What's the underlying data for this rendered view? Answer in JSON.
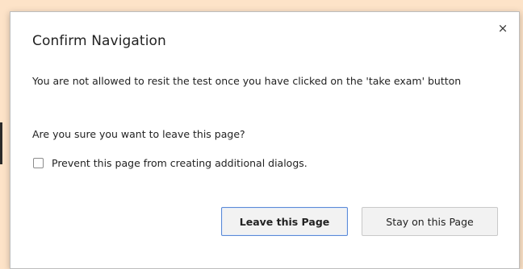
{
  "dialog": {
    "title": "Confirm Navigation",
    "close_symbol": "×",
    "message": "You are not allowed to resit the test once you have clicked on the 'take exam' button",
    "question": "Are you sure you want to leave this page?",
    "prevent_label": "Prevent this page from creating additional dialogs.",
    "prevent_checked": false,
    "leave_label": "Leave this Page",
    "stay_label": "Stay on this Page"
  },
  "colors": {
    "page_background": "#fde3c8",
    "focused_button_border": "#5b8ad6"
  },
  "icons": {
    "close": "close-icon",
    "checkbox": "checkbox-unchecked"
  }
}
